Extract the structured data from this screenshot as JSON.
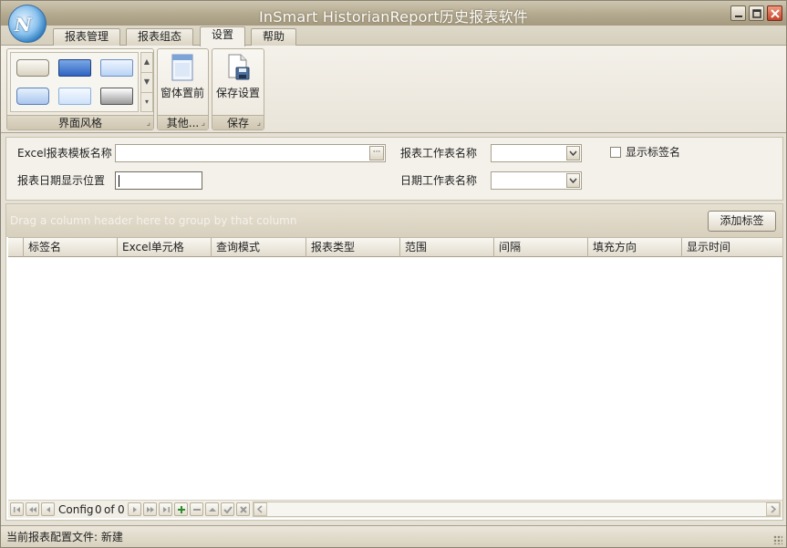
{
  "window": {
    "title": "InSmart HistorianReport历史报表软件"
  },
  "tabs": [
    {
      "label": "报表管理"
    },
    {
      "label": "报表组态"
    },
    {
      "label": "设置"
    },
    {
      "label": "帮助"
    }
  ],
  "ribbon": {
    "style_group_label": "界面风格",
    "other_group_label": "其他...",
    "save_group_label": "保存",
    "window_front_label": "窗体置前",
    "save_settings_label": "保存设置"
  },
  "form": {
    "excel_template_label": "Excel报表模板名称",
    "excel_template_value": "",
    "report_sheet_label": "报表工作表名称",
    "report_sheet_value": "",
    "show_tag_label": "显示标签名",
    "date_position_label": "报表日期显示位置",
    "date_position_value": "",
    "date_sheet_label": "日期工作表名称",
    "date_sheet_value": ""
  },
  "grid": {
    "group_hint": "Drag a column header here to group by that column",
    "add_tag_label": "添加标签",
    "columns": [
      "标签名",
      "Excel单元格",
      "查询模式",
      "报表类型",
      "范围",
      "间隔",
      "填充方向",
      "显示时间"
    ]
  },
  "navigator": {
    "record_prefix": "Config",
    "current": "0",
    "of_label": "of",
    "total": "0"
  },
  "status": {
    "text": "当前报表配置文件: 新建"
  }
}
